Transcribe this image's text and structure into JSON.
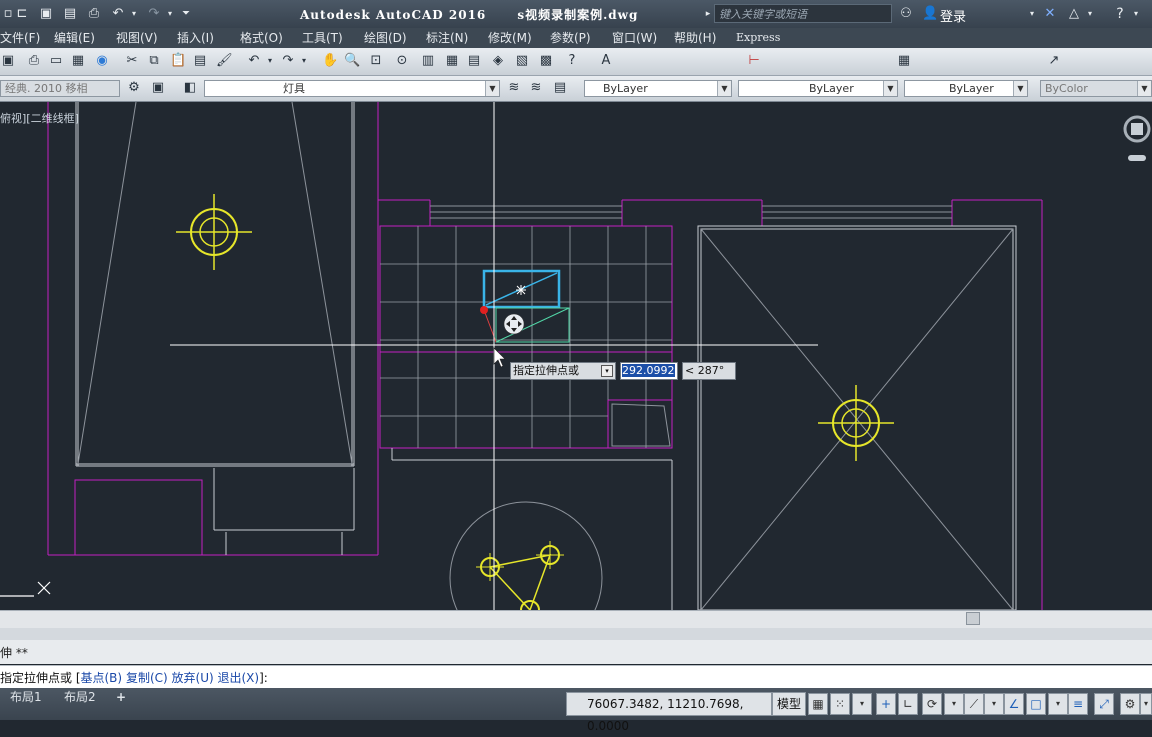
{
  "title_bar": {
    "app_title": "Autodesk AutoCAD 2016",
    "file_name": "s视频录制案例.dwg",
    "search_placeholder": "键入关键字或短语",
    "login_label": "登录"
  },
  "menu": {
    "items": [
      "文件(F)",
      "编辑(E)",
      "视图(V)",
      "插入(I)",
      "格式(O)",
      "工具(T)",
      "绘图(D)",
      "标注(N)",
      "修改(M)",
      "参数(P)",
      "窗口(W)",
      "帮助(H)",
      "Express"
    ]
  },
  "toolbar2": {
    "workspace_label": "经典. 2010 移相",
    "layer_label": "灯具",
    "color_label": "ByLayer",
    "linetype_label": "ByLayer",
    "lineweight_label": "ByLayer",
    "plotstyle_label": "ByColor"
  },
  "viewport": {
    "label": "俯视][二维线框]"
  },
  "dynamic_input": {
    "prompt": "指定拉伸点或",
    "distance": "292.0992",
    "angle": "< 287°"
  },
  "command": {
    "history": "伸 **",
    "prompt_prefix": "指定拉伸点或 [",
    "option_base": "基点(B)",
    "option_copy": "复制(C)",
    "option_undo": "放弃(U)",
    "option_exit": "退出(X)",
    "prompt_suffix": "]:"
  },
  "status": {
    "layout_tabs": [
      "布局1",
      "布局2"
    ],
    "add_tab": "+",
    "coordinates": "76067.3482, 11210.7698, 0.0000",
    "model_label": "模型"
  },
  "colors": {
    "canvas_bg": "#212830",
    "magenta_lines": "#c21fc2",
    "white_lines": "#c8ccd2",
    "yellow_fixtures": "#e6e62a",
    "selection_cyan": "#3ab4e8"
  }
}
